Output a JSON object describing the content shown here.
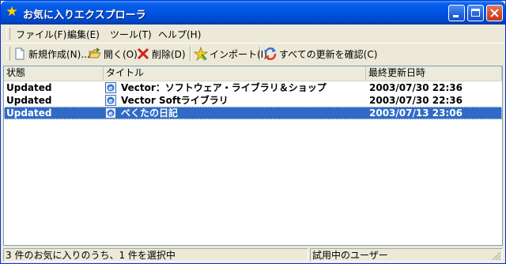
{
  "window": {
    "title": "お気に入りエクスプローラ"
  },
  "menu": [
    "ファイル(F)",
    "編集(E)",
    "ツール(T)",
    "ヘルプ(H)"
  ],
  "toolbar": {
    "new_label": "新規作成(N)...",
    "open_label": "開く(O)",
    "delete_label": "削除(D)",
    "import_label": "インポート(I)",
    "check_all_label": "すべての更新を確認(C)"
  },
  "list": {
    "columns": [
      "状態",
      "タイトル",
      "最終更新日時"
    ],
    "rows": [
      {
        "status": "Updated",
        "title": "Vector：ソフトウェア・ライブラリ＆ショップ",
        "updated": "2003/07/30 22:36",
        "selected": false
      },
      {
        "status": "Updated",
        "title": "Vector Softライブラリ",
        "updated": "2003/07/30 22:36",
        "selected": false
      },
      {
        "status": "Updated",
        "title": "べくたの日記",
        "updated": "2003/07/13 23:06",
        "selected": true
      }
    ]
  },
  "status": {
    "left": "3 件のお気に入りのうち、1 件を選択中",
    "right": "試用中のユーザー"
  },
  "colors": {
    "title_bar": "#0054e3",
    "selection": "#316ac5",
    "face": "#ece9d8"
  },
  "icons": [
    "star-icon",
    "new-document-icon",
    "open-folder-icon",
    "delete-x-icon",
    "import-star-icon",
    "check-updates-icon",
    "ie-page-icon"
  ]
}
